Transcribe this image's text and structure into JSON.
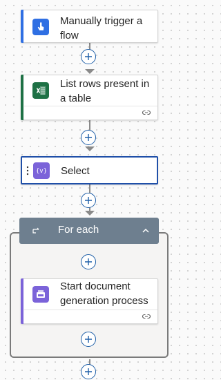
{
  "flow": {
    "steps": [
      {
        "id": "trigger",
        "title": "Manually trigger a flow",
        "accent": "#2f6fe3",
        "icon": "touch-trigger-icon"
      },
      {
        "id": "list-rows",
        "title": "List rows present in a table",
        "accent": "#1e7145",
        "icon": "excel-icon",
        "has_link": true
      },
      {
        "id": "select",
        "title": "Select",
        "accent": "#7b63d9",
        "icon": "data-operation-icon"
      },
      {
        "id": "doc-gen",
        "title": "Start document generation process",
        "accent": "#7b63d9",
        "icon": "document-generation-icon",
        "has_link": true
      }
    ],
    "foreach": {
      "title": "For each",
      "header_color": "#6e7f8f"
    }
  },
  "colors": {
    "add_button": "#1f5fa8",
    "connector": "#8a8a8a"
  }
}
